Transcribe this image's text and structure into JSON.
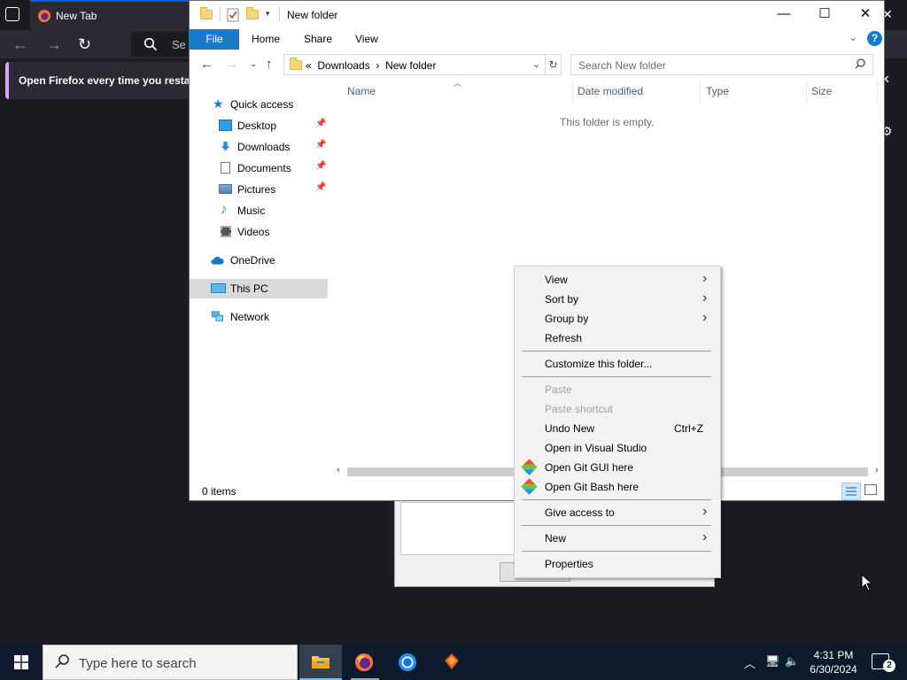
{
  "firefox": {
    "tab_title": "New Tab",
    "url_placeholder": "Se",
    "notice": "Open Firefox every time you resta"
  },
  "explorer": {
    "title": "New folder",
    "ribbon": {
      "file": "File",
      "home": "Home",
      "share": "Share",
      "view": "View"
    },
    "address": {
      "prefix": "«",
      "crumb1": "Downloads",
      "sep": "›",
      "crumb2": "New folder"
    },
    "search_placeholder": "Search New folder",
    "nav": {
      "quick_access": "Quick access",
      "desktop": "Desktop",
      "downloads": "Downloads",
      "documents": "Documents",
      "pictures": "Pictures",
      "music": "Music",
      "videos": "Videos",
      "onedrive": "OneDrive",
      "this_pc": "This PC",
      "network": "Network"
    },
    "columns": {
      "name": "Name",
      "date": "Date modified",
      "type": "Type",
      "size": "Size"
    },
    "empty_message": "This folder is empty.",
    "status": "0 items"
  },
  "context_menu": {
    "view": "View",
    "sort_by": "Sort by",
    "group_by": "Group by",
    "refresh": "Refresh",
    "customize": "Customize this folder...",
    "paste": "Paste",
    "paste_shortcut": "Paste shortcut",
    "undo_new": "Undo New",
    "undo_shortcut": "Ctrl+Z",
    "open_vs": "Open in Visual Studio",
    "git_gui": "Open Git GUI here",
    "git_bash": "Open Git Bash here",
    "give_access": "Give access to",
    "new": "New",
    "properties": "Properties"
  },
  "taskbar": {
    "search_placeholder": "Type here to search",
    "time": "4:31 PM",
    "date": "6/30/2024",
    "notification_count": "2"
  }
}
